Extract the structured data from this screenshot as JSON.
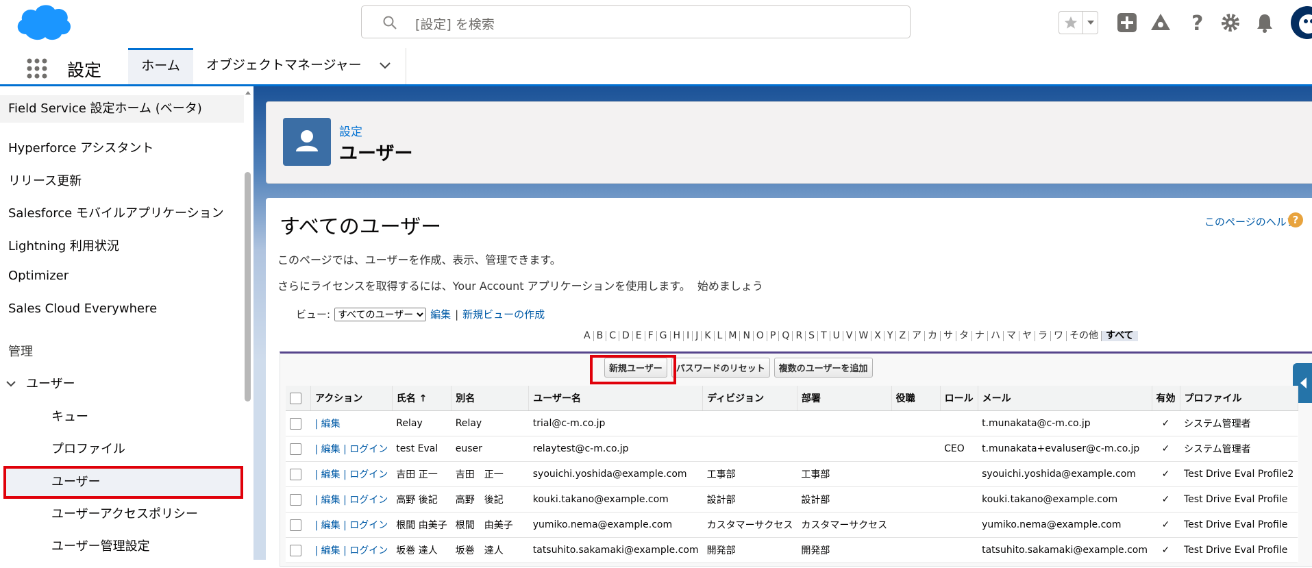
{
  "header": {
    "search_placeholder": "[設定] を検索"
  },
  "nav": {
    "app_name": "設定",
    "tabs": [
      {
        "label": "ホーム"
      },
      {
        "label": "オブジェクトマネージャー"
      }
    ]
  },
  "sidebar": {
    "items": [
      {
        "label": "Field Service 設定ホーム (ベータ)"
      },
      {
        "label": "Hyperforce アシスタント"
      },
      {
        "label": "リリース更新"
      },
      {
        "label": "Salesforce モバイルアプリケーション"
      },
      {
        "label": "Lightning 利用状況"
      },
      {
        "label": "Optimizer"
      },
      {
        "label": "Sales Cloud Everywhere"
      }
    ],
    "section": "管理",
    "group": "ユーザー",
    "sub_items": [
      {
        "label": "キュー"
      },
      {
        "label": "プロファイル"
      },
      {
        "label": "ユーザー"
      },
      {
        "label": "ユーザーアクセスポリシー"
      },
      {
        "label": "ユーザー管理設定"
      }
    ]
  },
  "page_header": {
    "breadcrumb": "設定",
    "title": "ユーザー"
  },
  "main": {
    "heading": "すべてのユーザー",
    "help_link": "このページのヘルプ",
    "description": "このページでは、ユーザーを作成、表示、管理できます。",
    "license_text": "さらにライセンスを取得するには、Your Account アプリケーションを使用します。",
    "license_link": "始めましょう",
    "view_label": "ビュー:",
    "view_selected": "すべてのユーザー",
    "view_edit": "編集",
    "view_sep": "|",
    "view_new": "新規ビューの作成",
    "alphabet": [
      "A",
      "B",
      "C",
      "D",
      "E",
      "F",
      "G",
      "H",
      "I",
      "J",
      "K",
      "L",
      "M",
      "N",
      "O",
      "P",
      "Q",
      "R",
      "S",
      "T",
      "U",
      "V",
      "W",
      "X",
      "Y",
      "Z",
      "ア",
      "カ",
      "サ",
      "タ",
      "ナ",
      "ハ",
      "マ",
      "ヤ",
      "ラ",
      "ワ",
      "その他",
      "すべて"
    ],
    "buttons": {
      "new_user": "新規ユーザー",
      "reset_password": "パスワードのリセット",
      "add_multiple": "複数のユーザーを追加"
    },
    "columns": [
      "アクション",
      "氏名 ↑",
      "別名",
      "ユーザー名",
      "ディビジョン",
      "部署",
      "役職",
      "ロール",
      "メール",
      "有効",
      "プロファイル"
    ],
    "rows": [
      {
        "actions": "| 編集",
        "name": "Relay",
        "alias": "Relay",
        "username": "trial@c-m.co.jp",
        "division": "",
        "department": "",
        "title": "",
        "role": "",
        "email": "t.munakata@c-m.co.jp",
        "active": "✓",
        "profile": "システム管理者"
      },
      {
        "actions": "| 編集 | ログイン",
        "name": "test Eval",
        "alias": "euser",
        "username": "relaytest@c-m.co.jp",
        "division": "",
        "department": "",
        "title": "",
        "role": "CEO",
        "email": "t.munakata+evaluser@c-m.co.jp",
        "active": "✓",
        "profile": "システム管理者"
      },
      {
        "actions": "| 編集 | ログイン",
        "name": "吉田 正一",
        "alias": "吉田　正一",
        "username": "syouichi.yoshida@example.com",
        "division": "工事部",
        "department": "工事部",
        "title": "",
        "role": "",
        "email": "syouichi.yoshida@example.com",
        "active": "✓",
        "profile": "Test Drive Eval Profile2"
      },
      {
        "actions": "| 編集 | ログイン",
        "name": "高野 後記",
        "alias": "高野　後記",
        "username": "kouki.takano@example.com",
        "division": "設計部",
        "department": "設計部",
        "title": "",
        "role": "",
        "email": "kouki.takano@example.com",
        "active": "✓",
        "profile": "Test Drive Eval Profile"
      },
      {
        "actions": "| 編集 | ログイン",
        "name": "根間 由美子",
        "alias": "根間　由美子",
        "username": "yumiko.nema@example.com",
        "division": "カスタマーサクセス",
        "department": "カスタマーサクセス",
        "title": "",
        "role": "",
        "email": "yumiko.nema@example.com",
        "active": "✓",
        "profile": "Test Drive Eval Profile"
      },
      {
        "actions": "| 編集 | ログイン",
        "name": "坂巻 達人",
        "alias": "坂巻　達人",
        "username": "tatsuhito.sakamaki@example.com",
        "division": "開発部",
        "department": "開発部",
        "title": "",
        "role": "",
        "email": "tatsuhito.sakamaki@example.com",
        "active": "✓",
        "profile": "Test Drive Eval Profile"
      }
    ]
  },
  "colors": {
    "brand_blue": "#0070d2",
    "cloud_blue": "#1b96ff",
    "highlight_red": "#e0000a",
    "page_icon": "#3b6ea5"
  },
  "icons": [
    "search-icon",
    "star-icon",
    "chevron-down-icon",
    "plus-icon",
    "trailhead-icon",
    "help-icon",
    "gear-icon",
    "bell-icon",
    "app-launcher-icon",
    "user-icon",
    "help-question-icon",
    "side-panel-arrow-icon"
  ]
}
